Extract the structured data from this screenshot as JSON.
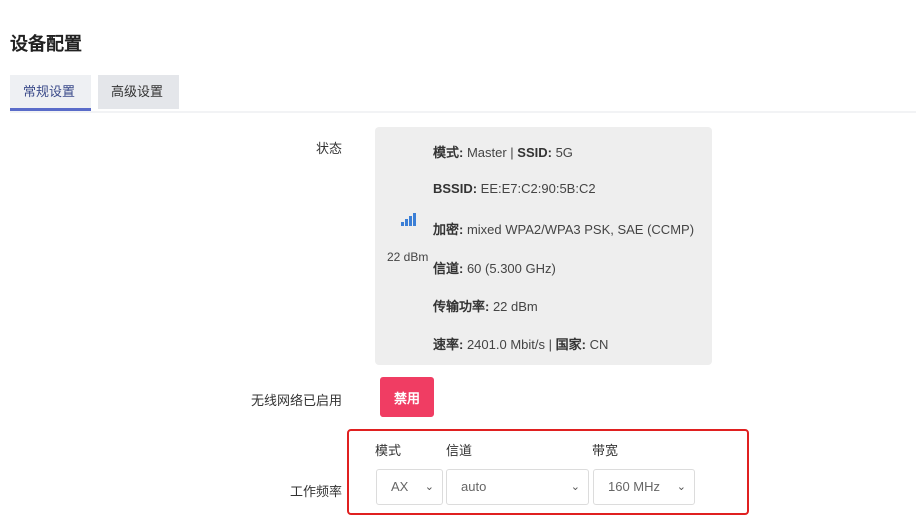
{
  "page": {
    "title": "设备配置"
  },
  "tabs": [
    {
      "label": "常规设置",
      "active": true
    },
    {
      "label": "高级设置",
      "active": false
    }
  ],
  "status": {
    "label": "状态",
    "signal_text": "22 dBm",
    "lines": [
      {
        "k1": "模式:",
        "v1": " Master | ",
        "k2": "SSID:",
        "v2": " 5G"
      },
      {
        "k1": "BSSID:",
        "v1": " EE:E7:C2:90:5B:C2",
        "k2": "",
        "v2": ""
      },
      {
        "k1": "加密:",
        "v1": " mixed WPA2/WPA3 PSK, SAE (CCMP)",
        "k2": "",
        "v2": ""
      },
      {
        "k1": "信道:",
        "v1": " 60 (5.300 GHz)",
        "k2": "",
        "v2": ""
      },
      {
        "k1": "传输功率:",
        "v1": " 22 dBm",
        "k2": "",
        "v2": ""
      },
      {
        "k1": "速率:",
        "v1": " 2401.0 Mbit/s | ",
        "k2": "国家:",
        "v2": " CN"
      }
    ]
  },
  "wireless": {
    "label": "无线网络已启用",
    "button": "禁用"
  },
  "frequency": {
    "label": "工作频率",
    "mode": {
      "label": "模式",
      "value": "AX"
    },
    "channel": {
      "label": "信道",
      "value": "auto"
    },
    "width": {
      "label": "带宽",
      "value": "160 MHz"
    }
  },
  "colors": {
    "accent": "#5a6cc9",
    "danger": "#f03d63",
    "highlight": "#e02020",
    "signal": "#3b7fd6"
  }
}
